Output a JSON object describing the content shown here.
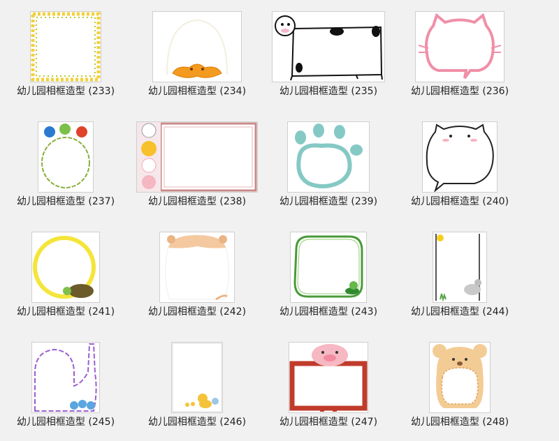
{
  "items": [
    {
      "label": "幼儿园相框造型 (233)",
      "icon": "lemon-border-frame"
    },
    {
      "label": "幼儿园相框造型 (234)",
      "icon": "duck-frame"
    },
    {
      "label": "幼儿园相框造型 (235)",
      "icon": "cow-frame"
    },
    {
      "label": "幼儿园相框造型 (236)",
      "icon": "pink-cat-frame"
    },
    {
      "label": "幼儿园相框造型 (237)",
      "icon": "birds-vine-frame"
    },
    {
      "label": "幼儿园相框造型 (238)",
      "icon": "animals-pink-frame"
    },
    {
      "label": "幼儿园相框造型 (239)",
      "icon": "paw-frame"
    },
    {
      "label": "幼儿园相框造型 (240)",
      "icon": "white-cat-frame"
    },
    {
      "label": "幼儿园相框造型 (241)",
      "icon": "turtle-yellow-circle-frame"
    },
    {
      "label": "幼儿园相框造型 (242)",
      "icon": "hamster-frame"
    },
    {
      "label": "幼儿园相框造型 (243)",
      "icon": "frog-green-frame"
    },
    {
      "label": "幼儿园相框造型 (244)",
      "icon": "goat-sun-frame"
    },
    {
      "label": "幼儿园相框造型 (245)",
      "icon": "purple-bunny-frame"
    },
    {
      "label": "幼儿园相框造型 (246)",
      "icon": "ducklings-frame"
    },
    {
      "label": "幼儿园相框造型 (247)",
      "icon": "pig-red-board-frame"
    },
    {
      "label": "幼儿园相框造型 (248)",
      "icon": "bear-frame"
    }
  ]
}
